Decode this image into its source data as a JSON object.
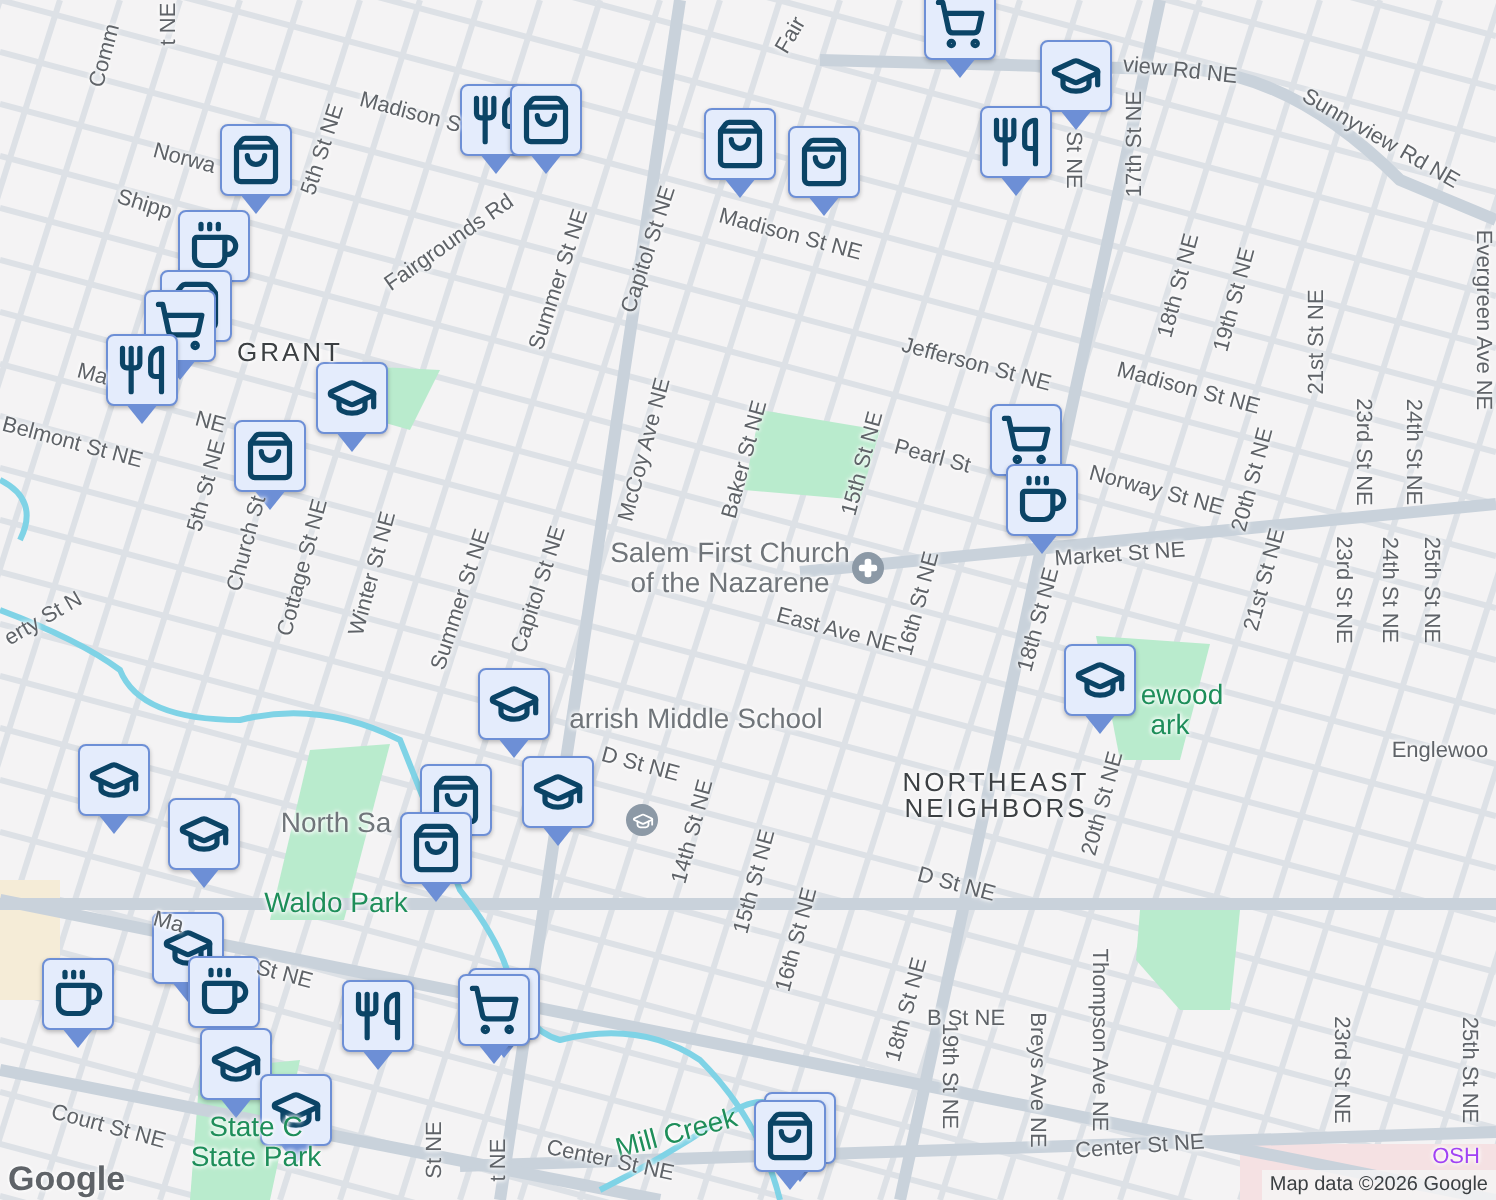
{
  "labels": [
    {
      "text": "Comm",
      "kind": "street"
    },
    {
      "text": "t NE",
      "kind": "street"
    },
    {
      "text": "Madison S",
      "kind": "street"
    },
    {
      "text": "Norwa",
      "kind": "street"
    },
    {
      "text": "5th St NE",
      "kind": "street"
    },
    {
      "text": "Shipp",
      "kind": "street"
    },
    {
      "text": "Fairgrounds Rd",
      "kind": "street"
    },
    {
      "text": "Summer St NE",
      "kind": "street"
    },
    {
      "text": "Capitol St NE",
      "kind": "street"
    },
    {
      "text": "Madison St NE",
      "kind": "street"
    },
    {
      "text": "Fair",
      "kind": "street"
    },
    {
      "text": "GRANT",
      "kind": "district"
    },
    {
      "text": "Ma",
      "kind": "street"
    },
    {
      "text": "NE",
      "kind": "street"
    },
    {
      "text": "Belmont St NE",
      "kind": "street"
    },
    {
      "text": "5th St NE",
      "kind": "street"
    },
    {
      "text": "Church St",
      "kind": "street"
    },
    {
      "text": "Cottage St NE",
      "kind": "street"
    },
    {
      "text": "Winter St NE",
      "kind": "street"
    },
    {
      "text": "Summer St NE",
      "kind": "street"
    },
    {
      "text": "Capitol St NE",
      "kind": "street"
    },
    {
      "text": "McCoy Ave NE",
      "kind": "street"
    },
    {
      "text": "Baker St NE",
      "kind": "street"
    },
    {
      "text": "Salem First Church",
      "kind": "place"
    },
    {
      "text": "of the Nazarene",
      "kind": "place"
    },
    {
      "text": "15th St NE",
      "kind": "street"
    },
    {
      "text": "Pearl St",
      "kind": "street"
    },
    {
      "text": "Norway St NE",
      "kind": "street"
    },
    {
      "text": "Market St NE",
      "kind": "street"
    },
    {
      "text": "Jefferson St NE",
      "kind": "street"
    },
    {
      "text": "Madison St NE",
      "kind": "street"
    },
    {
      "text": "Sunnyview Rd NE",
      "kind": "street"
    },
    {
      "text": "view Rd NE",
      "kind": "street"
    },
    {
      "text": "St NE",
      "kind": "street"
    },
    {
      "text": "17th St NE",
      "kind": "street"
    },
    {
      "text": "18th St NE",
      "kind": "street"
    },
    {
      "text": "19th St NE",
      "kind": "street"
    },
    {
      "text": "20th St NE",
      "kind": "street"
    },
    {
      "text": "21st St NE",
      "kind": "street"
    },
    {
      "text": "23rd St NE",
      "kind": "street"
    },
    {
      "text": "24th St NE",
      "kind": "street"
    },
    {
      "text": "Evergreen Ave NE",
      "kind": "street"
    },
    {
      "text": "21st St NE",
      "kind": "street"
    },
    {
      "text": "23rd St NE",
      "kind": "street"
    },
    {
      "text": "24th St NE",
      "kind": "street"
    },
    {
      "text": "25th St NE",
      "kind": "street"
    },
    {
      "text": "East Ave NE",
      "kind": "street"
    },
    {
      "text": "16th St NE",
      "kind": "street"
    },
    {
      "text": "18th St NE",
      "kind": "street"
    },
    {
      "text": "ewood",
      "kind": "park"
    },
    {
      "text": "ark",
      "kind": "park"
    },
    {
      "text": "Englewoo",
      "kind": "street"
    },
    {
      "text": "NORTHEAST",
      "kind": "district"
    },
    {
      "text": "NEIGHBORS",
      "kind": "district"
    },
    {
      "text": "D St NE",
      "kind": "street"
    },
    {
      "text": "20th St NE",
      "kind": "street"
    },
    {
      "text": "16th St NE",
      "kind": "street"
    },
    {
      "text": "18th St NE",
      "kind": "street"
    },
    {
      "text": "19th St NE",
      "kind": "street"
    },
    {
      "text": "B St NE",
      "kind": "street"
    },
    {
      "text": "Breys Ave NE",
      "kind": "street"
    },
    {
      "text": "Thompson Ave NE",
      "kind": "street"
    },
    {
      "text": "23rd St NE",
      "kind": "street"
    },
    {
      "text": "25th St NE",
      "kind": "street"
    },
    {
      "text": "Center St NE",
      "kind": "street"
    },
    {
      "text": "OSH",
      "kind": "poi"
    },
    {
      "text": "erty St N",
      "kind": "street"
    },
    {
      "text": "arrish Middle School",
      "kind": "place"
    },
    {
      "text": "D St NE",
      "kind": "street"
    },
    {
      "text": "North Sa",
      "kind": "place"
    },
    {
      "text": "14th St NE",
      "kind": "street"
    },
    {
      "text": "15th St NE",
      "kind": "street"
    },
    {
      "text": "Waldo Park",
      "kind": "park"
    },
    {
      "text": "Ma",
      "kind": "street"
    },
    {
      "text": "St NE",
      "kind": "street"
    },
    {
      "text": "Court St NE",
      "kind": "street"
    },
    {
      "text": "State C",
      "kind": "park"
    },
    {
      "text": "State Park",
      "kind": "park"
    },
    {
      "text": "St NE",
      "kind": "street"
    },
    {
      "text": "t NE",
      "kind": "street"
    },
    {
      "text": "Mill Creek",
      "kind": "park"
    },
    {
      "text": "Center St NE",
      "kind": "street"
    }
  ],
  "pins": [
    {
      "kind": "grocery"
    },
    {
      "kind": "school"
    },
    {
      "kind": "food"
    },
    {
      "kind": "shop"
    },
    {
      "kind": "shop"
    },
    {
      "kind": "food"
    },
    {
      "kind": "shop"
    },
    {
      "kind": "shop"
    },
    {
      "kind": "cafe"
    },
    {
      "kind": "shop"
    },
    {
      "kind": "grocery"
    },
    {
      "kind": "food"
    },
    {
      "kind": "school"
    },
    {
      "kind": "shop"
    },
    {
      "kind": "grocery"
    },
    {
      "kind": "cafe"
    },
    {
      "kind": "school"
    },
    {
      "kind": "school"
    },
    {
      "kind": "school"
    },
    {
      "kind": "shop"
    },
    {
      "kind": "shop"
    },
    {
      "kind": "school"
    },
    {
      "kind": "school"
    },
    {
      "kind": "cafe"
    },
    {
      "kind": "school"
    },
    {
      "kind": "cafe"
    },
    {
      "kind": "food"
    },
    {
      "kind": "grocery"
    },
    {
      "kind": "grocery"
    },
    {
      "kind": "school"
    },
    {
      "kind": "school"
    },
    {
      "kind": "shop"
    },
    {
      "kind": "shop"
    }
  ],
  "logo": "Google",
  "attribution": "Map data ©2026 Google"
}
